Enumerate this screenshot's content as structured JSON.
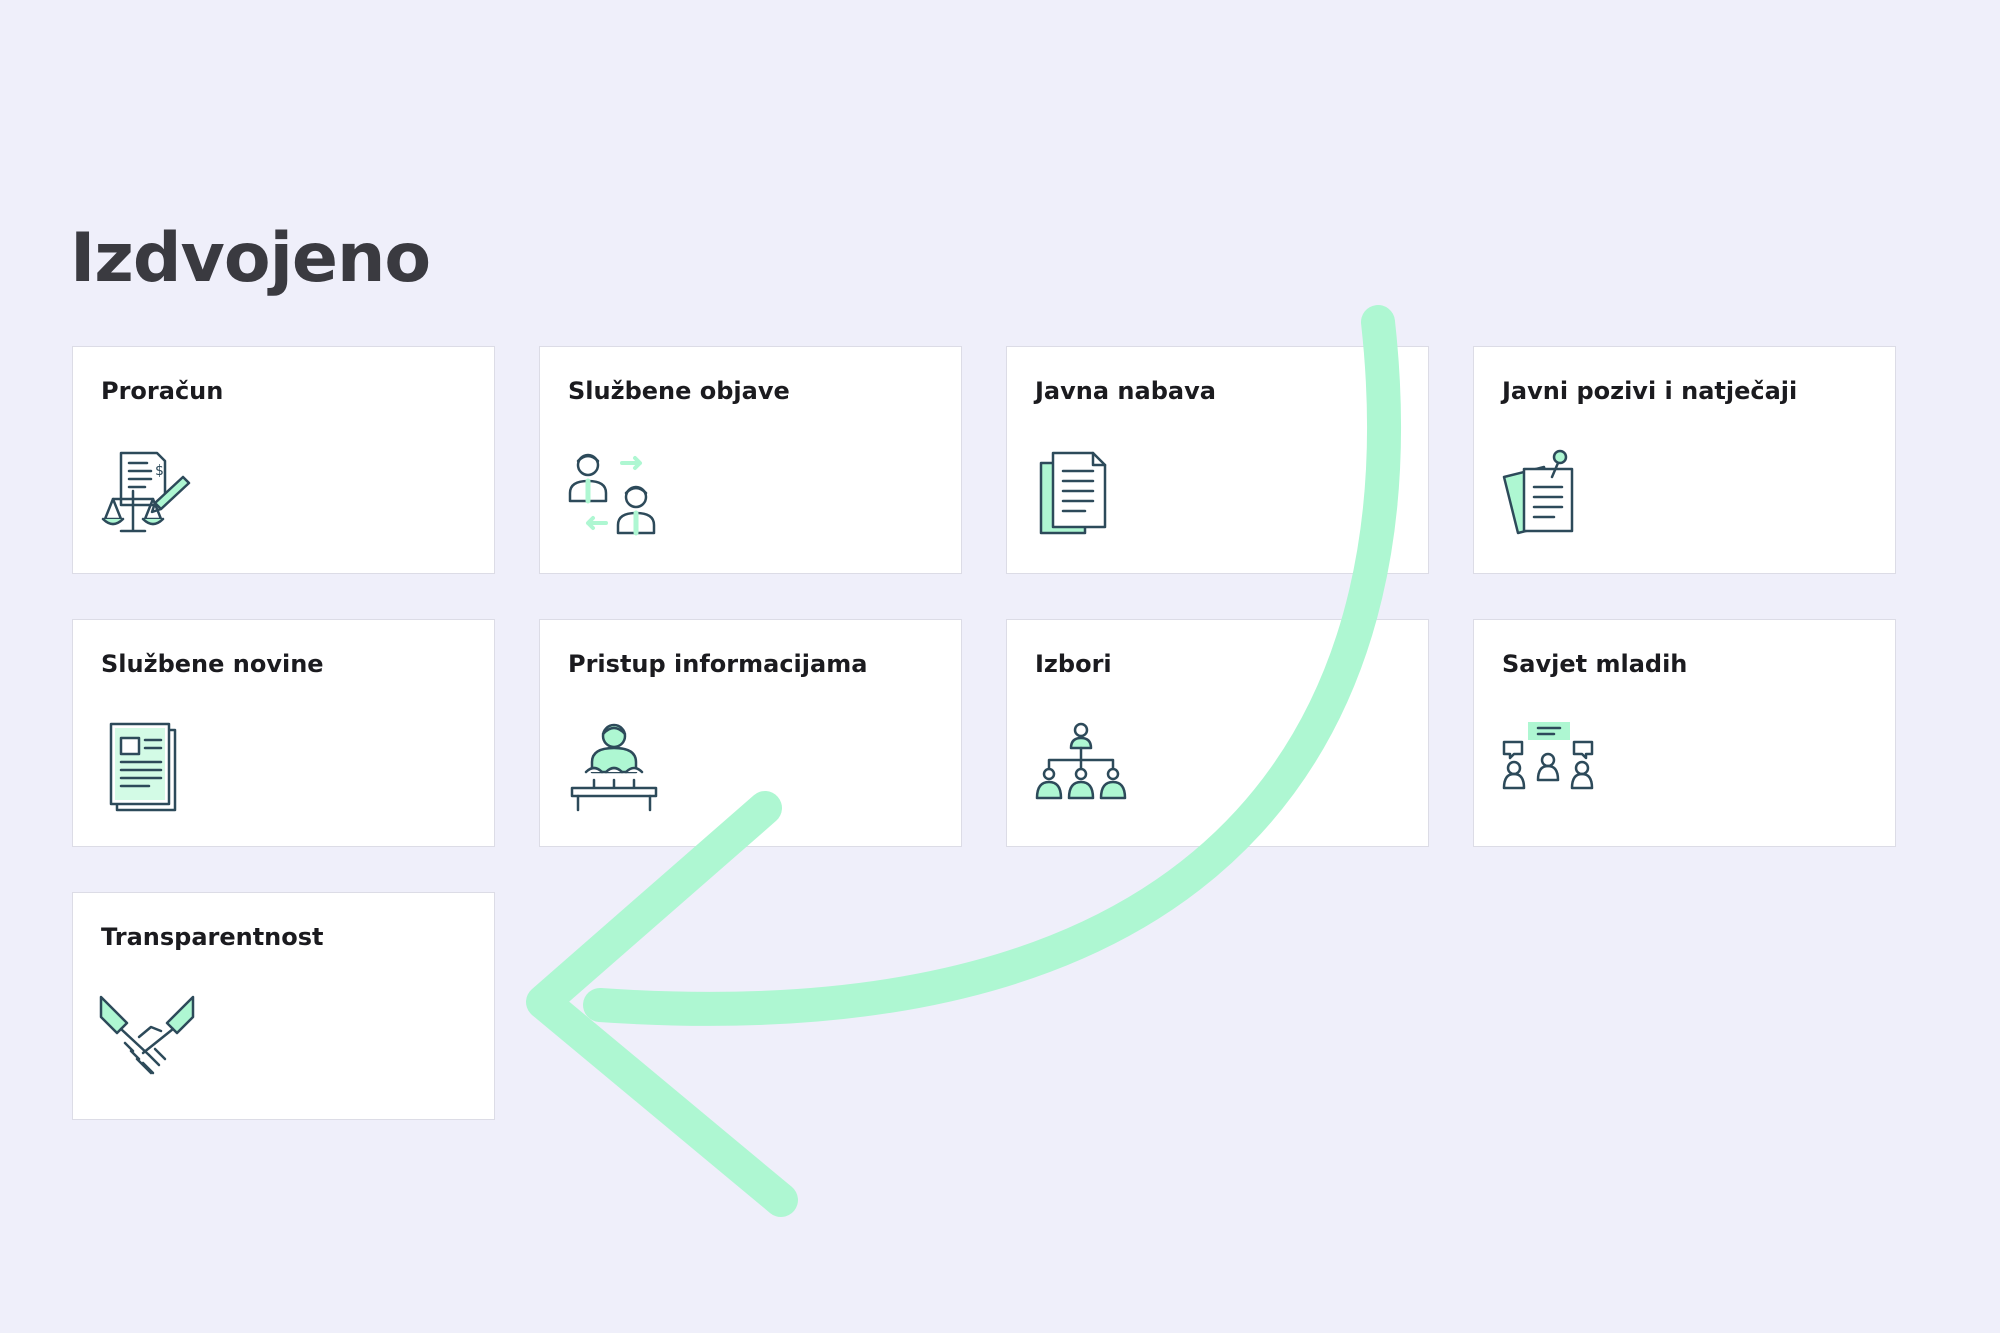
{
  "section": {
    "title": "Izdvojeno"
  },
  "cards": [
    {
      "title": "Proračun",
      "icon": "budget-scales-icon"
    },
    {
      "title": "Službene objave",
      "icon": "people-exchange-icon"
    },
    {
      "title": "Javna nabava",
      "icon": "documents-icon"
    },
    {
      "title": "Javni pozivi i natječaji",
      "icon": "pinned-notes-icon"
    },
    {
      "title": "Službene novine",
      "icon": "newspaper-icon"
    },
    {
      "title": "Pristup informacijama",
      "icon": "speaker-podium-icon"
    },
    {
      "title": "Izbori",
      "icon": "hierarchy-icon"
    },
    {
      "title": "Savjet mladih",
      "icon": "group-discussion-icon"
    },
    {
      "title": "Transparentnost",
      "icon": "handshake-icon"
    }
  ],
  "colors": {
    "background": "#efeffa",
    "accent": "#aef7d2",
    "icon_stroke": "#2d4a5a",
    "card": "#ffffff"
  }
}
